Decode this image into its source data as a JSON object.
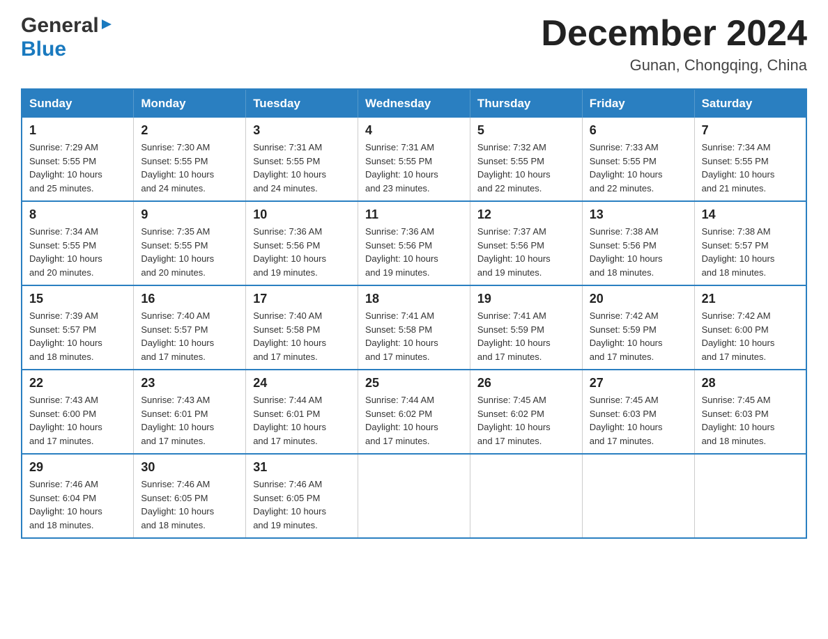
{
  "header": {
    "logo_general": "General",
    "logo_blue": "Blue",
    "month_title": "December 2024",
    "location": "Gunan, Chongqing, China"
  },
  "days_of_week": [
    "Sunday",
    "Monday",
    "Tuesday",
    "Wednesday",
    "Thursday",
    "Friday",
    "Saturday"
  ],
  "weeks": [
    [
      {
        "day": "1",
        "sunrise": "7:29 AM",
        "sunset": "5:55 PM",
        "daylight": "10 hours and 25 minutes."
      },
      {
        "day": "2",
        "sunrise": "7:30 AM",
        "sunset": "5:55 PM",
        "daylight": "10 hours and 24 minutes."
      },
      {
        "day": "3",
        "sunrise": "7:31 AM",
        "sunset": "5:55 PM",
        "daylight": "10 hours and 24 minutes."
      },
      {
        "day": "4",
        "sunrise": "7:31 AM",
        "sunset": "5:55 PM",
        "daylight": "10 hours and 23 minutes."
      },
      {
        "day": "5",
        "sunrise": "7:32 AM",
        "sunset": "5:55 PM",
        "daylight": "10 hours and 22 minutes."
      },
      {
        "day": "6",
        "sunrise": "7:33 AM",
        "sunset": "5:55 PM",
        "daylight": "10 hours and 22 minutes."
      },
      {
        "day": "7",
        "sunrise": "7:34 AM",
        "sunset": "5:55 PM",
        "daylight": "10 hours and 21 minutes."
      }
    ],
    [
      {
        "day": "8",
        "sunrise": "7:34 AM",
        "sunset": "5:55 PM",
        "daylight": "10 hours and 20 minutes."
      },
      {
        "day": "9",
        "sunrise": "7:35 AM",
        "sunset": "5:55 PM",
        "daylight": "10 hours and 20 minutes."
      },
      {
        "day": "10",
        "sunrise": "7:36 AM",
        "sunset": "5:56 PM",
        "daylight": "10 hours and 19 minutes."
      },
      {
        "day": "11",
        "sunrise": "7:36 AM",
        "sunset": "5:56 PM",
        "daylight": "10 hours and 19 minutes."
      },
      {
        "day": "12",
        "sunrise": "7:37 AM",
        "sunset": "5:56 PM",
        "daylight": "10 hours and 19 minutes."
      },
      {
        "day": "13",
        "sunrise": "7:38 AM",
        "sunset": "5:56 PM",
        "daylight": "10 hours and 18 minutes."
      },
      {
        "day": "14",
        "sunrise": "7:38 AM",
        "sunset": "5:57 PM",
        "daylight": "10 hours and 18 minutes."
      }
    ],
    [
      {
        "day": "15",
        "sunrise": "7:39 AM",
        "sunset": "5:57 PM",
        "daylight": "10 hours and 18 minutes."
      },
      {
        "day": "16",
        "sunrise": "7:40 AM",
        "sunset": "5:57 PM",
        "daylight": "10 hours and 17 minutes."
      },
      {
        "day": "17",
        "sunrise": "7:40 AM",
        "sunset": "5:58 PM",
        "daylight": "10 hours and 17 minutes."
      },
      {
        "day": "18",
        "sunrise": "7:41 AM",
        "sunset": "5:58 PM",
        "daylight": "10 hours and 17 minutes."
      },
      {
        "day": "19",
        "sunrise": "7:41 AM",
        "sunset": "5:59 PM",
        "daylight": "10 hours and 17 minutes."
      },
      {
        "day": "20",
        "sunrise": "7:42 AM",
        "sunset": "5:59 PM",
        "daylight": "10 hours and 17 minutes."
      },
      {
        "day": "21",
        "sunrise": "7:42 AM",
        "sunset": "6:00 PM",
        "daylight": "10 hours and 17 minutes."
      }
    ],
    [
      {
        "day": "22",
        "sunrise": "7:43 AM",
        "sunset": "6:00 PM",
        "daylight": "10 hours and 17 minutes."
      },
      {
        "day": "23",
        "sunrise": "7:43 AM",
        "sunset": "6:01 PM",
        "daylight": "10 hours and 17 minutes."
      },
      {
        "day": "24",
        "sunrise": "7:44 AM",
        "sunset": "6:01 PM",
        "daylight": "10 hours and 17 minutes."
      },
      {
        "day": "25",
        "sunrise": "7:44 AM",
        "sunset": "6:02 PM",
        "daylight": "10 hours and 17 minutes."
      },
      {
        "day": "26",
        "sunrise": "7:45 AM",
        "sunset": "6:02 PM",
        "daylight": "10 hours and 17 minutes."
      },
      {
        "day": "27",
        "sunrise": "7:45 AM",
        "sunset": "6:03 PM",
        "daylight": "10 hours and 17 minutes."
      },
      {
        "day": "28",
        "sunrise": "7:45 AM",
        "sunset": "6:03 PM",
        "daylight": "10 hours and 18 minutes."
      }
    ],
    [
      {
        "day": "29",
        "sunrise": "7:46 AM",
        "sunset": "6:04 PM",
        "daylight": "10 hours and 18 minutes."
      },
      {
        "day": "30",
        "sunrise": "7:46 AM",
        "sunset": "6:05 PM",
        "daylight": "10 hours and 18 minutes."
      },
      {
        "day": "31",
        "sunrise": "7:46 AM",
        "sunset": "6:05 PM",
        "daylight": "10 hours and 19 minutes."
      },
      null,
      null,
      null,
      null
    ]
  ],
  "labels": {
    "sunrise": "Sunrise: ",
    "sunset": "Sunset: ",
    "daylight": "Daylight: "
  }
}
